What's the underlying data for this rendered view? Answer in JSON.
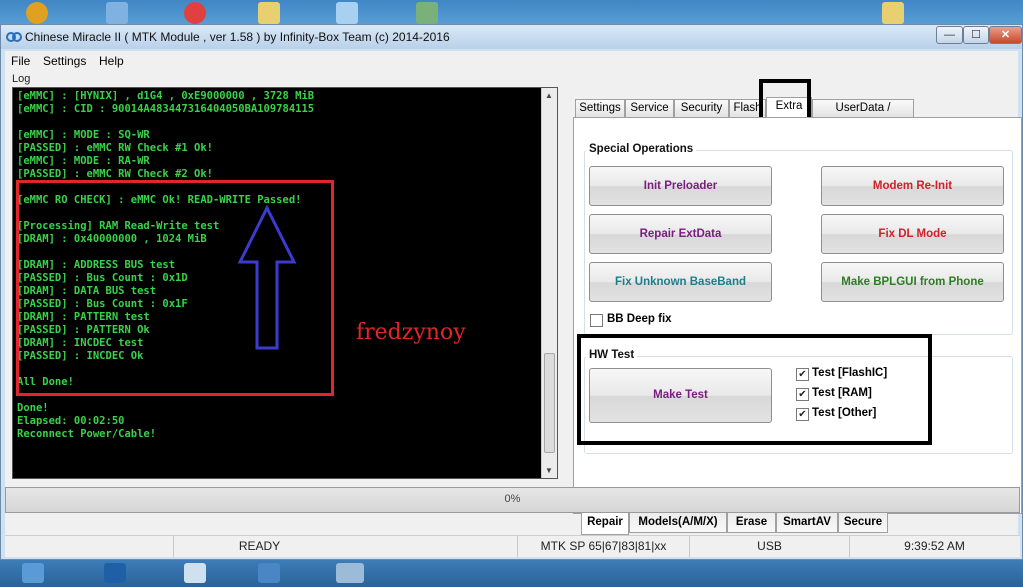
{
  "window": {
    "title": "Chinese Miracle II ( MTK Module , ver 1.58 ) by Infinity-Box Team (c) 2014-2016",
    "controls": {
      "minimize": "—",
      "maximize": "☐",
      "close": "✕"
    }
  },
  "menu": [
    "File",
    "Settings",
    "Help"
  ],
  "log": {
    "label": "Log",
    "lines": [
      "[eMMC] : [HYNIX] , d1G4 , 0xE9000000 , 3728 MiB",
      "[eMMC] : CID : 90014A483447316404050BA109784115",
      "",
      "[eMMC] : MODE : SQ-WR",
      "[PASSED] : eMMC RW Check #1 Ok!",
      "[eMMC] : MODE : RA-WR",
      "[PASSED] : eMMC RW Check #2 Ok!",
      "",
      "[eMMC RO CHECK] : eMMC Ok! READ-WRITE Passed!",
      "",
      "[Processing] RAM Read-Write test",
      "[DRAM] : 0x40000000 , 1024 MiB",
      "",
      "[DRAM] : ADDRESS BUS test",
      "[PASSED] : Bus Count : 0x1D",
      "[DRAM] : DATA BUS test",
      "[PASSED] : Bus Count : 0x1F",
      "[DRAM] : PATTERN test",
      "[PASSED] : PATTERN Ok",
      "[DRAM] : INCDEC test",
      "[PASSED] : INCDEC Ok",
      "",
      "All Done!",
      "",
      "Done!",
      "Elapsed: 00:02:50",
      "Reconnect Power/Cable!"
    ]
  },
  "watermark": "fredzynoy",
  "top_tabs": [
    "Settings",
    "Service",
    "Security",
    "Flash",
    "Extra",
    "UserData / Forensic"
  ],
  "special_ops": {
    "title": "Special Operations",
    "buttons": {
      "init_preloader": "Init Preloader",
      "modem_reinit": "Modem Re-Init",
      "repair_extdata": "Repair ExtData",
      "fix_dl_mode": "Fix DL Mode",
      "fix_baseband": "Fix Unknown BaseBand",
      "make_bplgui": "Make BPLGUI from Phone"
    },
    "bb_deep_fix": {
      "label": "BB Deep fix",
      "checked": false
    }
  },
  "hw_test": {
    "title": "HW Test",
    "button": "Make Test",
    "options": [
      {
        "label": "Test [FlashIC]",
        "checked": true
      },
      {
        "label": "Test [RAM]",
        "checked": true
      },
      {
        "label": "Test [Other]",
        "checked": true
      }
    ]
  },
  "bottom_tabs": [
    "Repair",
    "Models(A/M/X)",
    "Erase",
    "SmartAV",
    "Secure"
  ],
  "progress": {
    "value": 0,
    "label": "0%"
  },
  "status": {
    "state": "READY",
    "chip": "MTK SP 65|67|83|81|xx",
    "port": "USB",
    "time": "9:39:52 AM"
  },
  "colors": {
    "log_bg": "#000000",
    "log_text": "#39d24a",
    "annotation_red": "#e1252a",
    "annotation_blue": "#3b3bd0"
  }
}
